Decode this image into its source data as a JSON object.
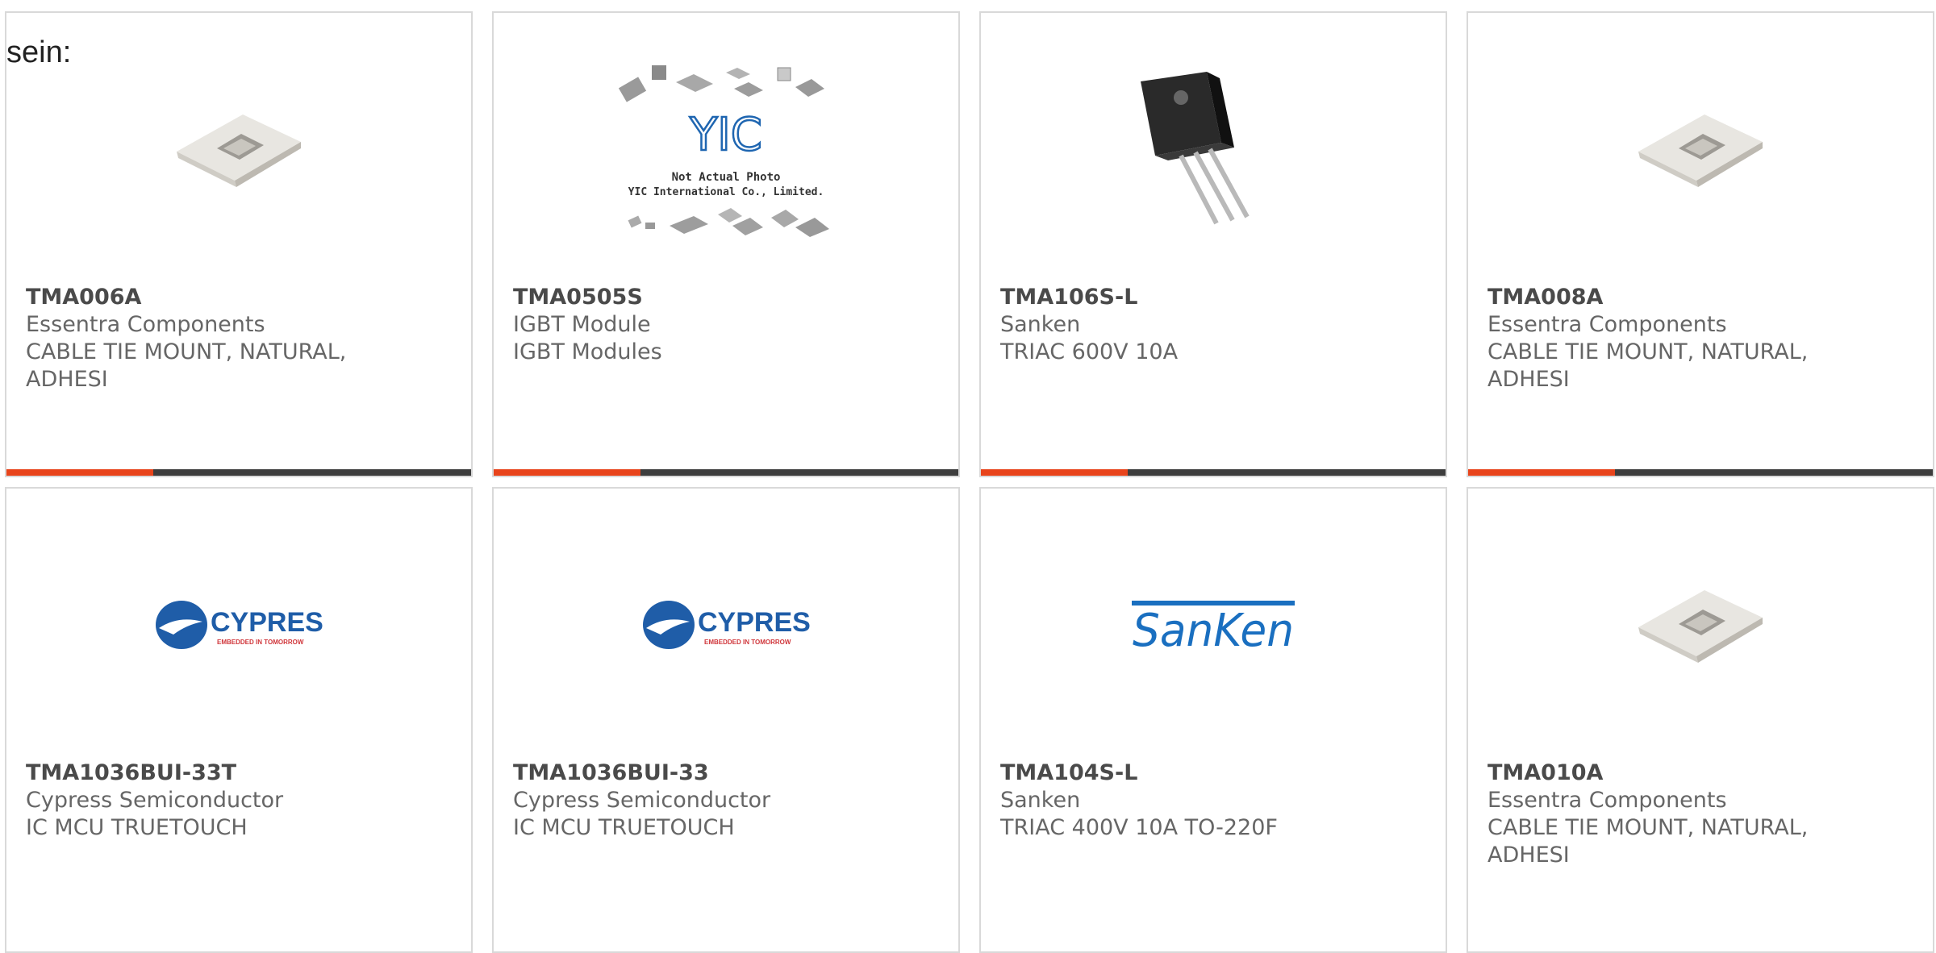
{
  "intro": {
    "text": "sein:"
  },
  "accent_color": "#e8441b",
  "bar_color": "#3d3d3d",
  "cards": [
    {
      "part": "TMA006A",
      "maker": "Essentra Components",
      "desc": "CABLE TIE MOUNT, NATURAL, ADHESI",
      "image": "cable-tie-mount"
    },
    {
      "part": "TMA0505S",
      "maker": "IGBT Module",
      "desc": "IGBT Modules",
      "image": "yic-placeholder",
      "yic": {
        "logo": "YIC",
        "line1": "Not Actual Photo",
        "line2": "YIC International Co., Limited."
      }
    },
    {
      "part": "TMA106S-L",
      "maker": "Sanken",
      "desc": "TRIAC 600V 10A",
      "image": "triac-to220"
    },
    {
      "part": "TMA008A",
      "maker": "Essentra Components",
      "desc": "CABLE TIE MOUNT, NATURAL, ADHESI",
      "image": "cable-tie-mount"
    },
    {
      "part": "TMA1036BUI-33T",
      "maker": "Cypress Semiconductor",
      "desc": "IC MCU TRUETOUCH",
      "image": "cypress-logo",
      "logo": {
        "name": "CYPRESS",
        "tagline": "EMBEDDED IN TOMORROW"
      }
    },
    {
      "part": "TMA1036BUI-33",
      "maker": "Cypress Semiconductor",
      "desc": "IC MCU TRUETOUCH",
      "image": "cypress-logo",
      "logo": {
        "name": "CYPRESS",
        "tagline": "EMBEDDED IN TOMORROW"
      }
    },
    {
      "part": "TMA104S-L",
      "maker": "Sanken",
      "desc": "TRIAC 400V 10A TO-220F",
      "image": "sanken-logo",
      "logo": {
        "name": "SanKen"
      }
    },
    {
      "part": "TMA010A",
      "maker": "Essentra Components",
      "desc": "CABLE TIE MOUNT, NATURAL, ADHESI",
      "image": "cable-tie-mount"
    }
  ]
}
